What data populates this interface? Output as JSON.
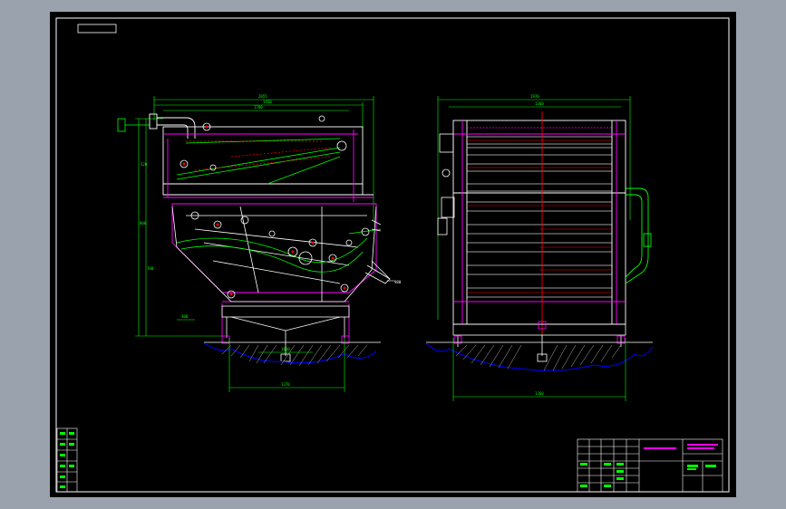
{
  "app": {
    "viewport_background": "#9aa3ad",
    "canvas_background": "#000000"
  },
  "colors": {
    "frame": "#ffffff",
    "green": "#00ff00",
    "magenta": "#ff00ff",
    "red": "#ff0000",
    "blue": "#0000ff",
    "gray": "#b0b0b0",
    "cyan": "#00ffff"
  },
  "drawing": {
    "left_view": {
      "name": "front-elevation",
      "dimension_labels": [
        "2055",
        "1450",
        "1700",
        "520",
        "700",
        "980",
        "800",
        "1370",
        "1600",
        "300"
      ]
    },
    "right_view": {
      "name": "side-elevation",
      "dimension_labels": [
        "1970",
        "1360",
        "1800"
      ]
    },
    "title_block": {
      "cells": [
        "",
        "",
        "",
        "",
        "",
        ""
      ],
      "drawing_no_label": "",
      "project_label": ""
    },
    "revision_table": {
      "rows": 6
    }
  }
}
